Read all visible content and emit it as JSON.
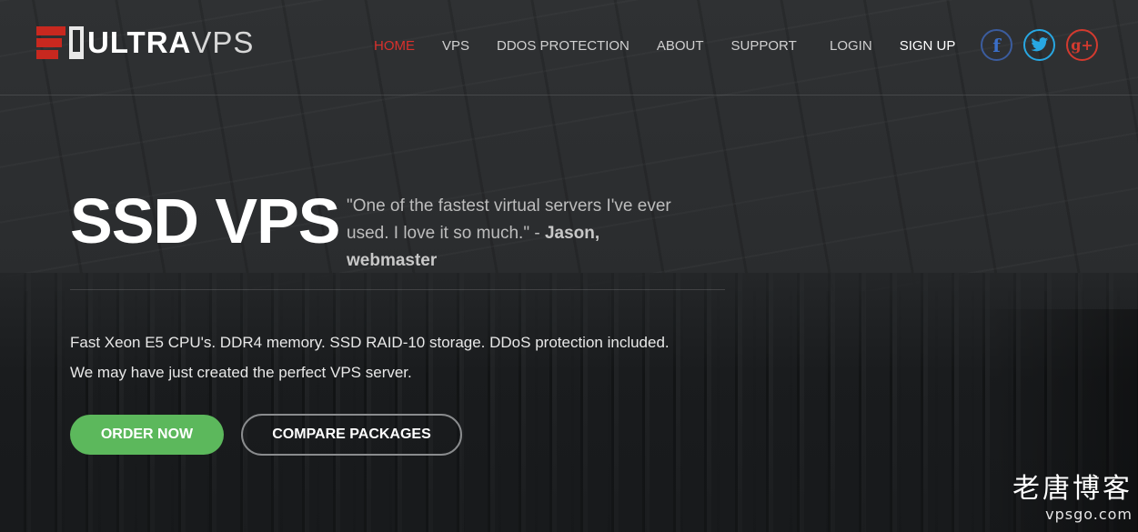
{
  "brand": {
    "name_bold": "ULTRA",
    "name_light": "VPS",
    "accent_red": "#c8281f"
  },
  "nav": {
    "items": [
      {
        "label": "HOME",
        "active": true
      },
      {
        "label": "VPS",
        "active": false
      },
      {
        "label": "DDOS PROTECTION",
        "active": false
      },
      {
        "label": "ABOUT",
        "active": false
      },
      {
        "label": "SUPPORT",
        "active": false
      }
    ],
    "login": "LOGIN",
    "signup": "SIGN UP"
  },
  "social": {
    "facebook_glyph": "f",
    "twitter_glyph": "t",
    "google_glyph": "g+",
    "colors": {
      "facebook": "#3b5c9e",
      "twitter": "#28a7e2",
      "google": "#d33a2f"
    }
  },
  "hero": {
    "title": "SSD VPS",
    "quote_text": "\"One of the fastest virtual servers I've ever used. I love it so much.\" - ",
    "quote_author": "Jason, webmaster",
    "desc_line1": "Fast Xeon E5 CPU's. DDR4 memory. SSD RAID-10 storage. DDoS protection included.",
    "desc_line2": "We may have just created the perfect VPS server.",
    "order_button": "ORDER NOW",
    "compare_button": "COMPARE PACKAGES",
    "order_color": "#5cb85c"
  },
  "watermark": {
    "chinese": "老唐博客",
    "url": "vpsgo.com"
  }
}
